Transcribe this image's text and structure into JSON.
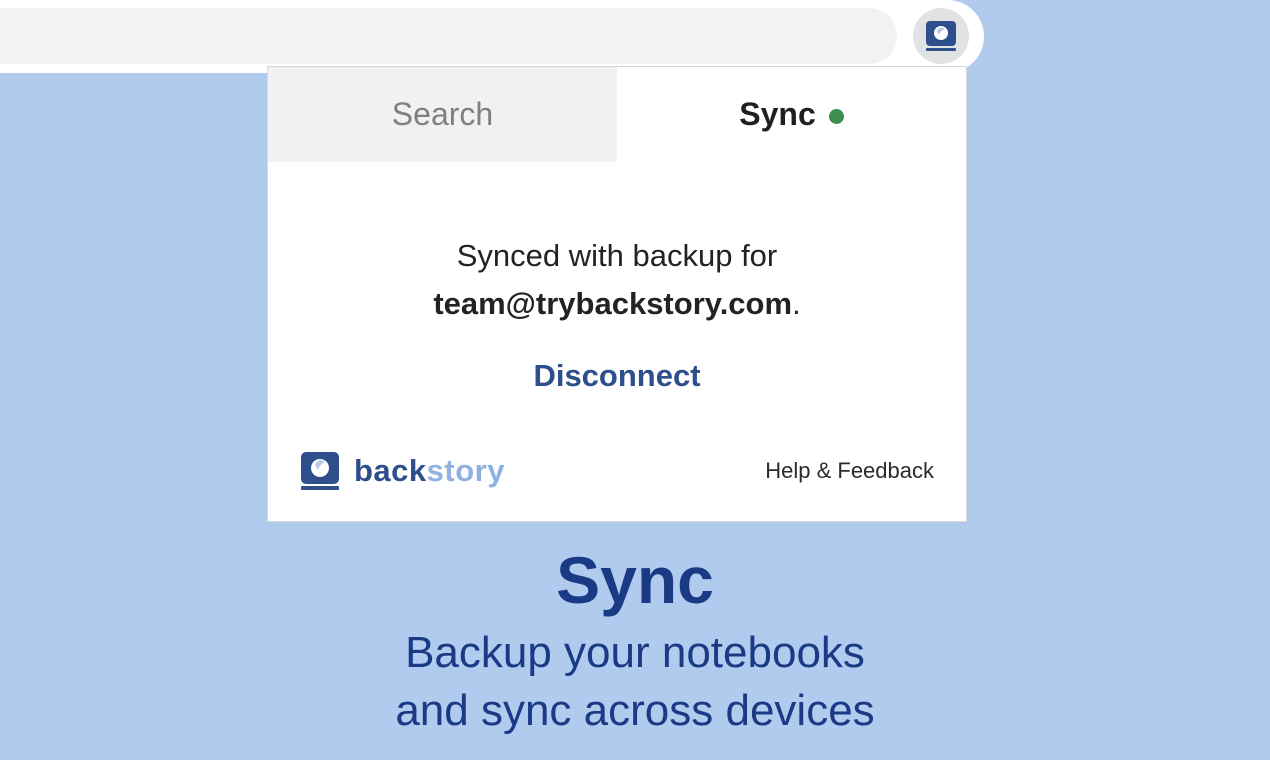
{
  "tabs": {
    "search_label": "Search",
    "sync_label": "Sync",
    "sync_status_color": "#3e8e50"
  },
  "sync_panel": {
    "synced_text": "Synced with backup for",
    "email": "team@trybackstory.com",
    "email_suffix": ".",
    "disconnect_label": "Disconnect"
  },
  "footer": {
    "brand_part1": "back",
    "brand_part2": "story",
    "help_label": "Help & Feedback",
    "logo_icon": "book-icon"
  },
  "caption": {
    "title": "Sync",
    "subtitle_line1": "Backup your notebooks",
    "subtitle_line2": "and sync across devices"
  },
  "colors": {
    "background": "#b1cbef",
    "brand_dark": "#2e4f8c",
    "brand_light": "#8fb0e0",
    "caption_text": "#1b3a86"
  }
}
